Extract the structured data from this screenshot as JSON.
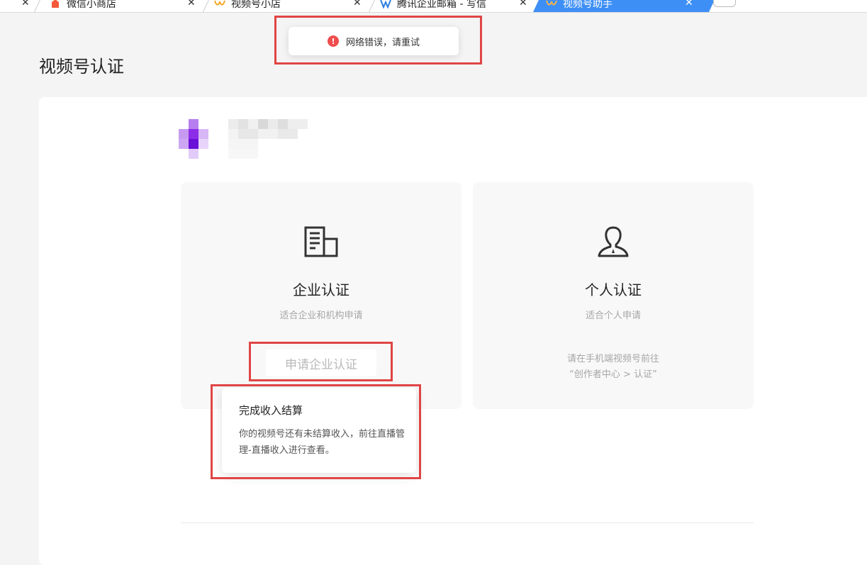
{
  "tabs": [
    {
      "title": "微信小商店",
      "icon": "wechat-shop-icon",
      "color": "#f25a3a"
    },
    {
      "title": "视频号小店",
      "icon": "channels-shop-icon",
      "color": "#f5a623"
    },
    {
      "title": "腾讯企业邮箱 - 写信",
      "icon": "exmail-icon",
      "color": "#2a7de1"
    },
    {
      "title": "视频号助手",
      "icon": "channels-assistant-icon",
      "color": "#f5a623",
      "active": true
    }
  ],
  "toast": {
    "message": "网络错误，请重试",
    "icon": "error-icon",
    "color": "#f04e4e"
  },
  "page": {
    "title": "视频号认证"
  },
  "cards": {
    "enterprise": {
      "title": "企业认证",
      "desc": "适合企业和机构申请",
      "button": "申请企业认证",
      "icon": "building-icon"
    },
    "personal": {
      "title": "个人认证",
      "desc": "适合个人申请",
      "note_line1": "请在手机端视频号前往",
      "note_line2": "“创作者中心 > 认证”",
      "icon": "person-icon"
    }
  },
  "popover": {
    "title": "完成收入结算",
    "body": "你的视频号还有未结算收入，前往直播管理-直播收入进行查看。"
  },
  "colors": {
    "accent": "#3e8ff5",
    "annotation": "#e04545",
    "error": "#f04e4e"
  }
}
